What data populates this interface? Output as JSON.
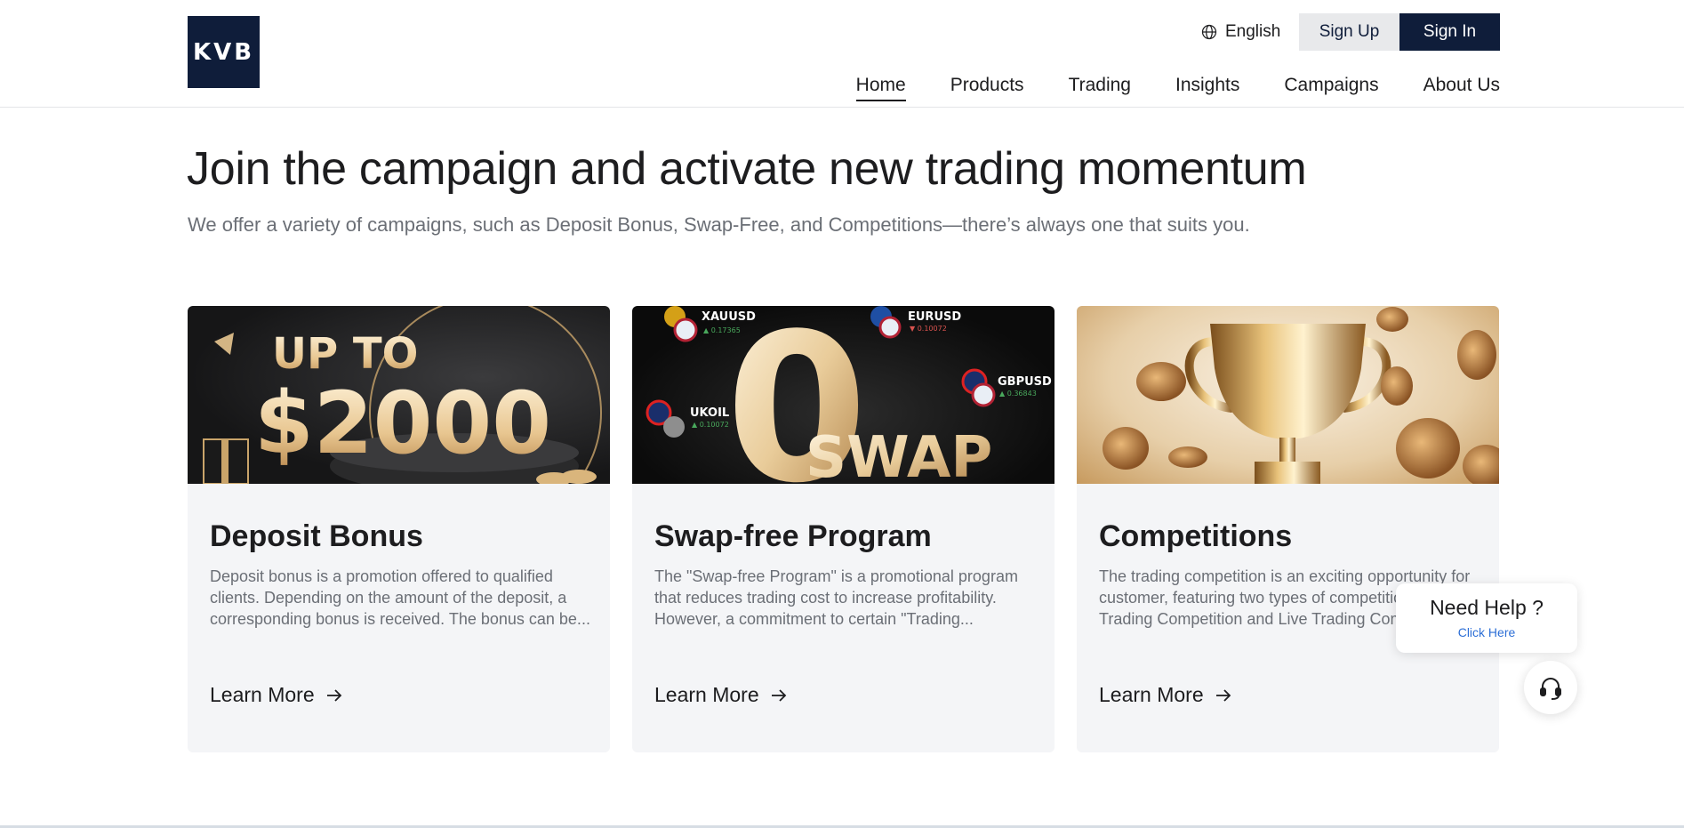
{
  "header": {
    "logo_text": "KVB",
    "language": "English",
    "signup_label": "Sign Up",
    "signin_label": "Sign In",
    "nav": [
      "Home",
      "Products",
      "Trading",
      "Insights",
      "Campaigns",
      "About Us"
    ],
    "active_nav": "Home"
  },
  "hero": {
    "title": "Join the campaign and activate new trading momentum",
    "subtitle": "We offer a variety of campaigns, such as Deposit Bonus, Swap-Free, and Competitions—there’s always one that suits you."
  },
  "cards": [
    {
      "title": "Deposit Bonus",
      "description": "Deposit bonus is a promotion offered to qualified clients. Depending on the amount of the deposit, a corresponding bonus is received. The bonus can be...",
      "link": "Learn More",
      "image_text": {
        "line1": "UP TO",
        "line2": "$2000"
      }
    },
    {
      "title": "Swap-free Program",
      "description": "The \"Swap-free Program\" is a promotional program that reduces trading cost to increase profitability. However, a commitment to certain \"Trading...",
      "link": "Learn More",
      "image_text": {
        "big": "0",
        "word": "SWAP",
        "tickers": [
          {
            "name": "XAUUSD",
            "change": "▲ 0.17365"
          },
          {
            "name": "EURUSD",
            "change": "▼ 0.10072"
          },
          {
            "name": "GBPUSD",
            "change": "▲ 0.36843"
          },
          {
            "name": "UKOIL",
            "change": "▲ 0.10072"
          }
        ]
      }
    },
    {
      "title": "Competitions",
      "description": "The trading competition is an exciting opportunity for customer, featuring two types of competitions: Demo Trading Competition and Live Trading Competition...",
      "link": "Learn More"
    }
  ],
  "help": {
    "title": "Need Help ?",
    "link": "Click Here"
  },
  "colors": {
    "brand_navy": "#0f1d3a",
    "card_bg": "#f4f5f7",
    "link_blue": "#2d6fd6"
  }
}
